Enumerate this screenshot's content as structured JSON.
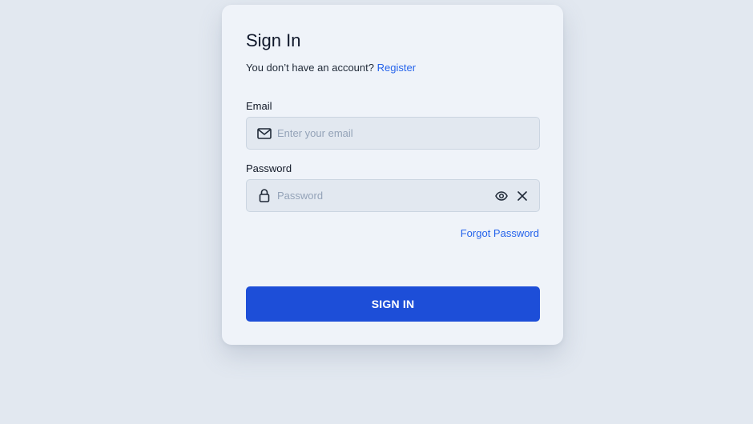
{
  "form": {
    "title": "Sign In",
    "no_account_text": "You don’t have an account?",
    "register_link": "Register",
    "email_label": "Email",
    "email_placeholder": "Enter your email",
    "email_value": "",
    "password_label": "Password",
    "password_placeholder": "Password",
    "password_value": "",
    "forgot_password_link": "Forgot Password",
    "submit_label": "SIGN IN"
  },
  "icons": {
    "email": "mail-icon",
    "password": "lock-icon",
    "show_password": "eye-icon",
    "clear": "close-icon"
  },
  "colors": {
    "background": "#e2e8f0",
    "card": "#eff3f9",
    "link": "#2563eb",
    "primary_button": "#1d4ed8"
  }
}
